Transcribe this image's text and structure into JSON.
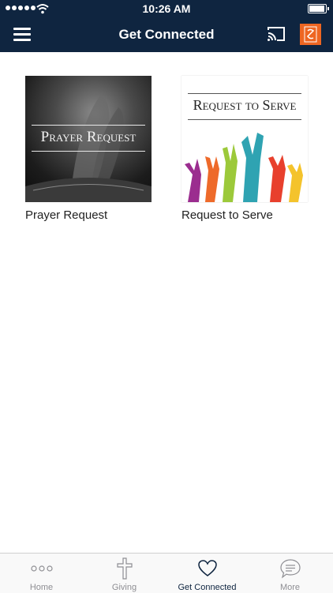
{
  "status": {
    "time": "10:26 AM"
  },
  "header": {
    "title": "Get Connected"
  },
  "tiles": [
    {
      "label": "Prayer Request",
      "image_text": "Prayer Request"
    },
    {
      "label": "Request to Serve",
      "image_text": "Request to Serve"
    }
  ],
  "tabbar": {
    "tabs": [
      {
        "label": "Home",
        "icon": "dots-icon"
      },
      {
        "label": "Giving",
        "icon": "cross-icon"
      },
      {
        "label": "Get Connected",
        "icon": "heart-icon"
      },
      {
        "label": "More",
        "icon": "chat-bubble-icon"
      }
    ],
    "active_index": 2
  },
  "colors": {
    "bar_bg": "#0f2540",
    "logo": "#ee6622",
    "tab_inactive": "#8e8e93"
  }
}
